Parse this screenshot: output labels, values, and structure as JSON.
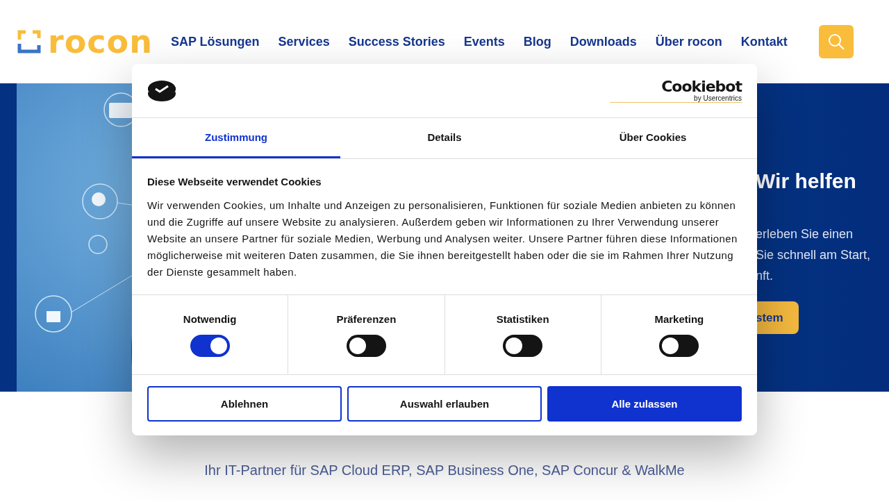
{
  "header": {
    "logo": "rocon",
    "nav": [
      "SAP Lösungen",
      "Services",
      "Success Stories",
      "Events",
      "Blog",
      "Downloads",
      "Über rocon",
      "Kontakt"
    ]
  },
  "hero": {
    "kind": "picture",
    "title": "Wir helfen",
    "lines": [
      "erleben Sie einen",
      "Sie schnell am Start,",
      "nft."
    ],
    "button": "stem"
  },
  "tagline": "Ihr IT-Partner für SAP Cloud ERP, SAP Business One, SAP Concur & WalkMe",
  "cookie_dialog": {
    "brand": "Cookiebot",
    "brand_sub": "by Usercentrics",
    "tabs": [
      {
        "label": "Zustimmung",
        "selected": true
      },
      {
        "label": "Details",
        "selected": false
      },
      {
        "label": "Über Cookies",
        "selected": false
      }
    ],
    "heading": "Diese Webseite verwendet Cookies",
    "text": "Wir verwenden Cookies, um Inhalte und Anzeigen zu personalisieren, Funktionen für soziale Medien anbieten zu können und die Zugriffe auf unsere Website zu analysieren. Außerdem geben wir Informationen zu Ihrer Verwendung unserer Website an unsere Partner für soziale Medien, Werbung und Analysen weiter. Unsere Partner führen diese Informationen möglicherweise mit weiteren Daten zusammen, die Sie ihnen bereitgestellt haben oder die sie im Rahmen Ihrer Nutzung der Dienste gesammelt haben.",
    "categories": [
      {
        "label": "Notwendig",
        "on": true
      },
      {
        "label": "Präferenzen",
        "on": false
      },
      {
        "label": "Statistiken",
        "on": false
      },
      {
        "label": "Marketing",
        "on": false
      }
    ],
    "buttons": [
      {
        "label": "Ablehnen",
        "kind": "outline"
      },
      {
        "label": "Auswahl erlauben",
        "kind": "outline"
      },
      {
        "label": "Alle zulassen",
        "kind": "primary"
      }
    ]
  }
}
